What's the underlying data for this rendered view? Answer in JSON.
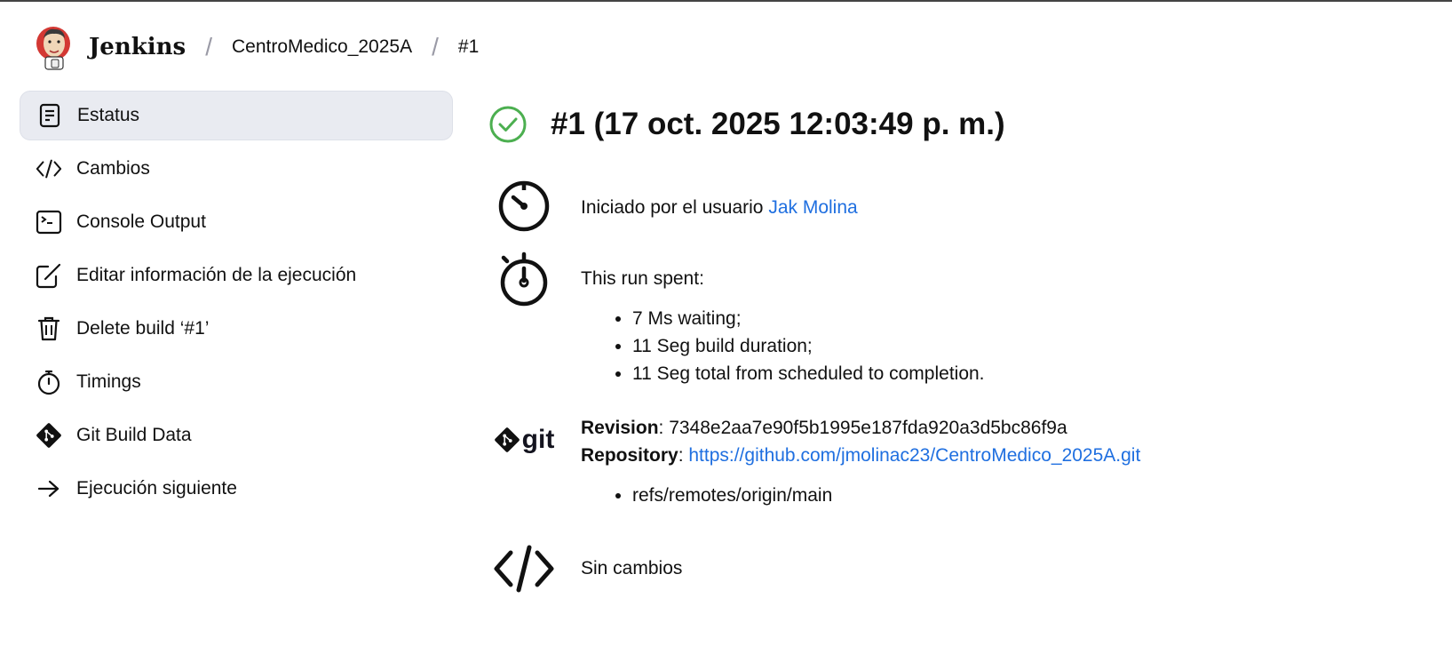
{
  "header": {
    "brand": "Jenkins",
    "breadcrumbs": [
      "CentroMedico_2025A",
      "#1"
    ]
  },
  "sidebar": {
    "items": [
      {
        "label": "Estatus",
        "icon": "document-icon",
        "active": true
      },
      {
        "label": "Cambios",
        "icon": "code-icon"
      },
      {
        "label": "Console Output",
        "icon": "terminal-icon"
      },
      {
        "label": "Editar información de la ejecución",
        "icon": "edit-icon"
      },
      {
        "label": "Delete build ‘#1’",
        "icon": "trash-icon"
      },
      {
        "label": "Timings",
        "icon": "stopwatch-icon"
      },
      {
        "label": "Git Build Data",
        "icon": "git-icon"
      },
      {
        "label": "Ejecución siguiente",
        "icon": "arrow-right-icon"
      }
    ]
  },
  "main": {
    "title": "#1 (17 oct. 2025 12:03:49 p. m.)",
    "started_by_prefix": "Iniciado por el usuario",
    "started_by_user": "Jak Molina",
    "run_spent_label": "This run spent:",
    "run_spent_items": [
      "7 Ms waiting;",
      "11 Seg build duration;",
      "11 Seg total from scheduled to completion."
    ],
    "git": {
      "logo_text": "git",
      "revision_label": "Revision",
      "revision_value": "7348e2aa7e90f5b1995e187fda920a3d5bc86f9a",
      "repository_label": "Repository",
      "repository_url": "https://github.com/jmolinac23/CentroMedico_2025A.git",
      "refs": [
        "refs/remotes/origin/main"
      ]
    },
    "changes_text": "Sin cambios"
  },
  "colors": {
    "success": "#4caf50",
    "link": "#1f6fe0",
    "active_bg": "#e9ebf1"
  }
}
